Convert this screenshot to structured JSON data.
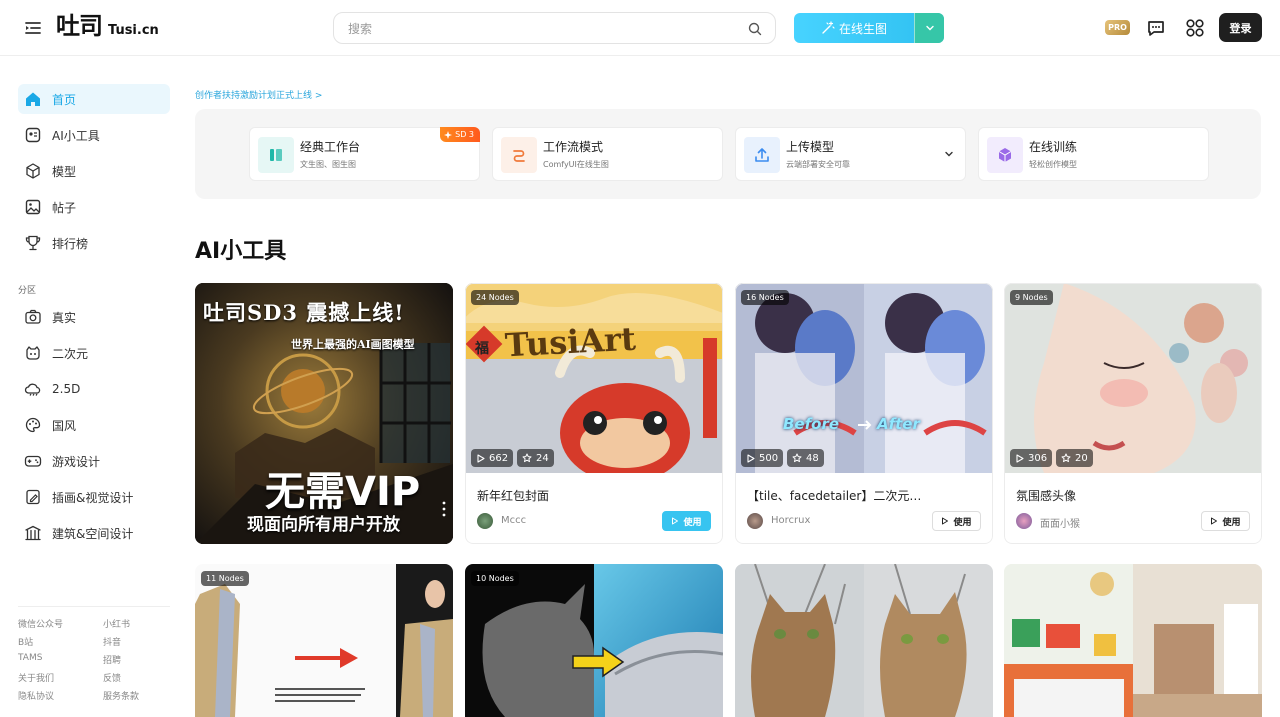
{
  "header": {
    "logo_main": "吐司",
    "logo_sub": "Tusi.cn",
    "search_placeholder": "搜索",
    "generate_label": "在线生图",
    "pro_label": "PRO",
    "login_label": "登录"
  },
  "sidebar": {
    "items": [
      {
        "label": "首页",
        "icon": "home-icon"
      },
      {
        "label": "AI小工具",
        "icon": "ai-tool-icon"
      },
      {
        "label": "模型",
        "icon": "cube-icon"
      },
      {
        "label": "帖子",
        "icon": "image-icon"
      },
      {
        "label": "排行榜",
        "icon": "trophy-icon"
      }
    ],
    "section_label": "分区",
    "categories": [
      {
        "label": "真实",
        "icon": "camera-icon"
      },
      {
        "label": "二次元",
        "icon": "anime-face-icon"
      },
      {
        "label": "2.5D",
        "icon": "cloud-icon"
      },
      {
        "label": "国风",
        "icon": "palette-icon"
      },
      {
        "label": "游戏设计",
        "icon": "gamepad-icon"
      },
      {
        "label": "插画&视觉设计",
        "icon": "illustration-icon"
      },
      {
        "label": "建筑&空间设计",
        "icon": "building-icon"
      }
    ],
    "footer_left": [
      "微信公众号",
      "B站",
      "TAMS",
      "关于我们",
      "隐私协议"
    ],
    "footer_right": [
      "小红书",
      "抖音",
      "招聘",
      "反馈",
      "服务条款"
    ]
  },
  "main": {
    "announcement": "创作者扶持激励计划正式上线 >",
    "quick_actions": [
      {
        "title": "经典工作台",
        "subtitle": "文生图、图生图",
        "badge": "SD 3",
        "color": "#1fb8a8",
        "bg": "#e6f7f5"
      },
      {
        "title": "工作流模式",
        "subtitle": "ComfyUI在线生图",
        "badge": "",
        "color": "#f07a3a",
        "bg": "#fdf0e8"
      },
      {
        "title": "上传模型",
        "subtitle": "云端部署安全可靠",
        "badge": "",
        "color": "#3b8cf0",
        "bg": "#e8f1fd"
      },
      {
        "title": "在线训练",
        "subtitle": "轻松创作模型",
        "badge": "",
        "color": "#9a6ae8",
        "bg": "#f2ecfd"
      }
    ],
    "section_title": "AI小工具",
    "banner": {
      "line1": "吐司SD3 震撼上线!",
      "line2": "世界上最强的AI画图模型",
      "line3": "无需VIP",
      "line4": "现面向所有用户开放"
    },
    "cards": [
      {
        "nodes": "24 Nodes",
        "runs": "662",
        "stars": "24",
        "title": "新年红包封面",
        "author": "Mccc",
        "use_label": "使用"
      },
      {
        "nodes": "16 Nodes",
        "runs": "500",
        "stars": "48",
        "title": "【tile、facedetailer】二次元超强修复超...",
        "author": "Horcrux",
        "use_label": "使用"
      },
      {
        "nodes": "9 Nodes",
        "runs": "306",
        "stars": "20",
        "title": "氛围感头像",
        "author": "面面小猴",
        "use_label": "使用"
      }
    ],
    "bottom_cards": [
      {
        "nodes": "11 Nodes"
      },
      {
        "nodes": "10 Nodes"
      },
      {
        "nodes": ""
      },
      {
        "nodes": ""
      }
    ],
    "card1_image_text": {
      "brand": "TusiArt",
      "fu": "福"
    },
    "card2_image_text": {
      "before": "Before",
      "after": "After"
    }
  }
}
